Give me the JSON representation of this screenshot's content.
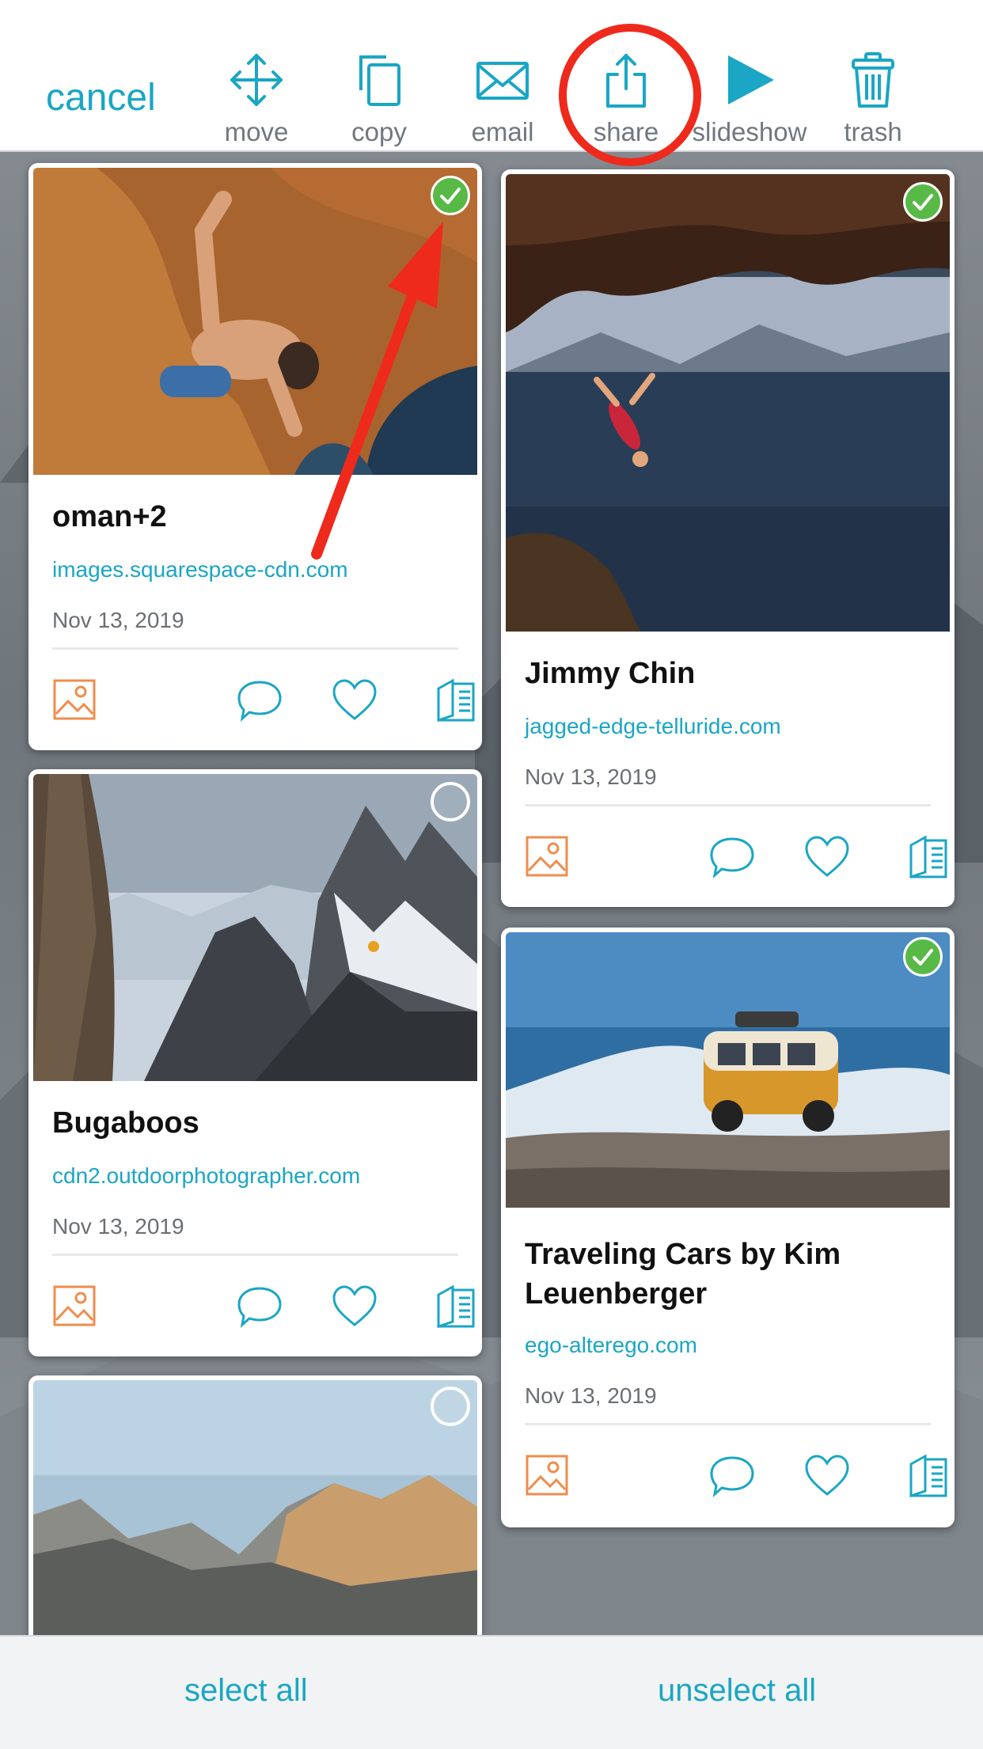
{
  "toolbar": {
    "cancel_label": "cancel",
    "tools": [
      {
        "label": "move",
        "icon": "move-icon"
      },
      {
        "label": "copy",
        "icon": "copy-icon"
      },
      {
        "label": "email",
        "icon": "email-icon"
      },
      {
        "label": "share",
        "icon": "share-icon"
      },
      {
        "label": "slideshow",
        "icon": "play-icon"
      },
      {
        "label": "trash",
        "icon": "trash-icon"
      }
    ],
    "accent_color": "#1aa6c4"
  },
  "cards": [
    {
      "title": "oman+2",
      "source": "images.squarespace-cdn.com",
      "date": "Nov 13, 2019",
      "selected": true
    },
    {
      "title": "Jimmy Chin",
      "source": "jagged-edge-telluride.com",
      "date": "Nov 13, 2019",
      "selected": true
    },
    {
      "title": "Bugaboos",
      "source": "cdn2.outdoorphotographer.com",
      "date": "Nov 13, 2019",
      "selected": false
    },
    {
      "title": "Traveling Cars by Kim Leuenberger",
      "source": "ego-alterego.com",
      "date": "Nov 13, 2019",
      "selected": true
    },
    {
      "title": "",
      "source": "",
      "date": "",
      "selected": false
    }
  ],
  "bottom": {
    "select_all": "select all",
    "unselect_all": "unselect all"
  },
  "colors": {
    "annotation": "#ee2a1c",
    "check": "#58b947",
    "image_icon": "#ef8d4d"
  }
}
